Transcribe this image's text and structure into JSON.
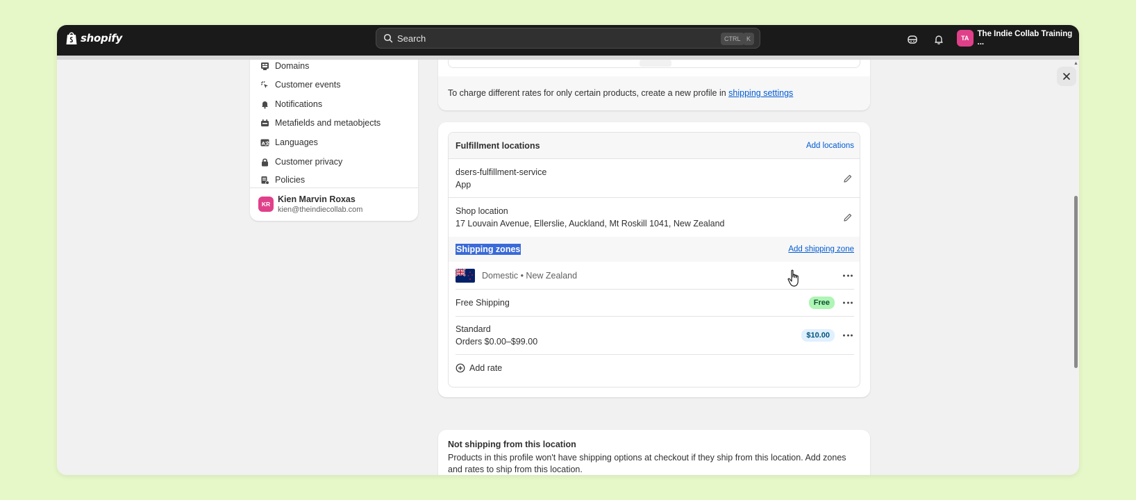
{
  "topbar": {
    "brand": "shopify",
    "search_placeholder": "Search",
    "kbd_ctrl": "CTRL",
    "kbd_k": "K",
    "store_initials": "TA",
    "store_name": "The Indie Collab Training ..."
  },
  "sidebar": {
    "items": [
      {
        "label": "Domains",
        "icon": "domains-icon"
      },
      {
        "label": "Customer events",
        "icon": "cursor-click-icon"
      },
      {
        "label": "Notifications",
        "icon": "bell-icon"
      },
      {
        "label": "Metafields and metaobjects",
        "icon": "metafields-icon"
      },
      {
        "label": "Languages",
        "icon": "language-icon"
      },
      {
        "label": "Customer privacy",
        "icon": "lock-icon"
      },
      {
        "label": "Policies",
        "icon": "policy-icon"
      }
    ],
    "user": {
      "initials": "KR",
      "name": "Kien Marvin Roxas",
      "email": "kien@theindiecollab.com"
    }
  },
  "profile_card": {
    "footer_text": "To charge different rates for only certain products, create a new profile in ",
    "footer_link": "shipping settings"
  },
  "fulfillment": {
    "title": "Fulfillment locations",
    "add_locations": "Add locations",
    "locations": [
      {
        "name": "dsers-fulfillment-service",
        "detail": "App"
      },
      {
        "name": "Shop location",
        "detail": "17 Louvain Avenue, Ellerslie, Auckland, Mt Roskill 1041, New Zealand"
      }
    ],
    "zones_title": "Shipping zones",
    "add_zone": "Add shipping zone",
    "zone": {
      "name": "Domestic • New Zealand"
    },
    "rates": [
      {
        "name": "Free Shipping",
        "detail": "",
        "badge": "Free"
      },
      {
        "name": "Standard",
        "detail": "Orders $0.00–$99.00",
        "badge": "$10.00"
      }
    ],
    "add_rate": "Add rate"
  },
  "not_shipping": {
    "title": "Not shipping from this location",
    "body": "Products in this profile won't have shipping options at checkout if they ship from this location. Add zones and rates to ship from this location."
  },
  "colors": {
    "accent": "#005bd3",
    "highlight": "#3a6ad9",
    "free_badge": "#aff5b4",
    "price_badge": "#e0f0ff",
    "avatar": "#e0408a"
  }
}
